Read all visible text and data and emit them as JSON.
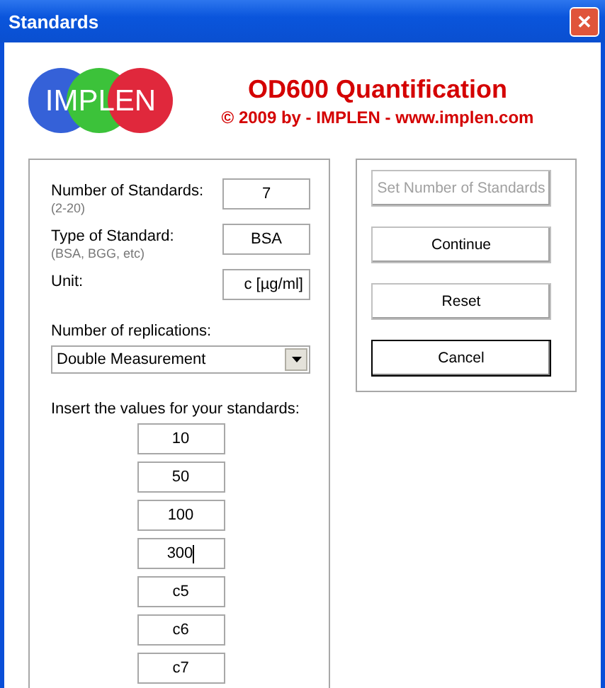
{
  "window": {
    "title": "Standards",
    "close": "✕"
  },
  "header": {
    "logo_text": "IMPLEN",
    "title": "OD600 Quantification",
    "copyright": "© 2009 by - IMPLEN - www.implen.com"
  },
  "fields": [
    {
      "label": "Number of Standards:",
      "hint": "(2-20)",
      "value": "7"
    },
    {
      "label": "Type of Standard:",
      "hint": "(BSA, BGG, etc)",
      "value": "BSA"
    },
    {
      "label": "Unit:",
      "value": "c [µg/ml]"
    }
  ],
  "replications": {
    "label": "Number of replications:",
    "value": "Double Measurement"
  },
  "standards": {
    "label": "Insert the values for your standards:",
    "values": [
      {
        "value": "10",
        "focused": false
      },
      {
        "value": "50",
        "focused": false
      },
      {
        "value": "100",
        "focused": false
      },
      {
        "value": "300",
        "focused": true
      },
      {
        "value": "c5",
        "focused": false
      },
      {
        "value": "c6",
        "focused": false
      },
      {
        "value": "c7",
        "focused": false
      }
    ]
  },
  "buttons": [
    {
      "label": "Set Number of Standards",
      "disabled": true,
      "default": false
    },
    {
      "label": "Continue",
      "disabled": false,
      "default": false
    },
    {
      "label": "Reset",
      "disabled": false,
      "default": false
    },
    {
      "label": "Cancel",
      "disabled": false,
      "default": true
    }
  ]
}
